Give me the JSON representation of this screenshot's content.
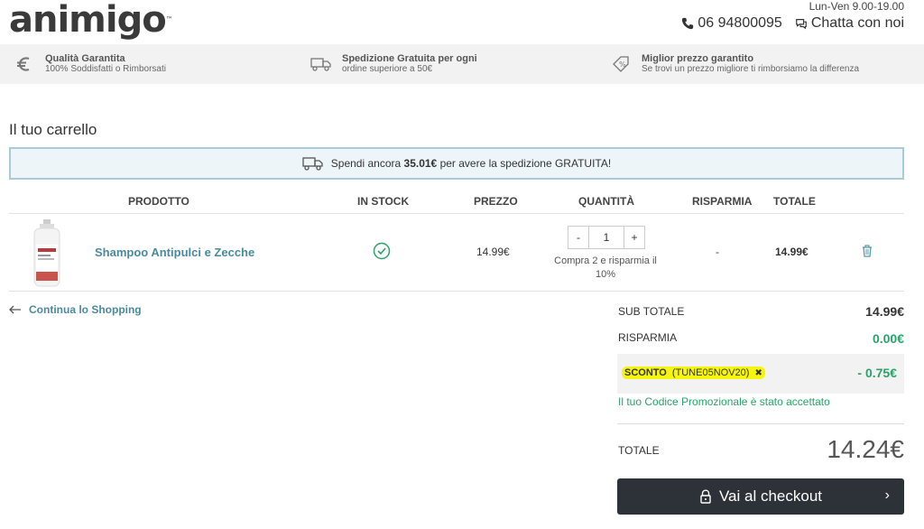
{
  "header": {
    "logo": "animigo",
    "logo_tm": "™",
    "hours": "Lun-Ven 9.00-19.00",
    "phone": "06 94800095",
    "chat": "Chatta con noi"
  },
  "benefits": [
    {
      "icon": "euro-icon",
      "title": "Qualità Garantita",
      "subtitle": "100% Soddisfatti o Rimborsati"
    },
    {
      "icon": "truck-icon",
      "title": "Spedizione Gratuita per ogni",
      "subtitle": "ordine superiore a 50€"
    },
    {
      "icon": "percent-tag-icon",
      "title": "Miglior prezzo garantito",
      "subtitle": "Se trovi un prezzo migliore ti rimborsiamo la differenza"
    }
  ],
  "cart": {
    "title": "Il tuo carrello",
    "shipping_banner": {
      "prefix": "Spendi ancora",
      "amount": "35.01€",
      "suffix": "per avere la spedizione GRATUITA!"
    },
    "columns": {
      "product": "PRODOTTO",
      "in_stock": "IN STOCK",
      "price": "PREZZO",
      "quantity": "QUANTITÀ",
      "savings": "RISPARMIA",
      "total": "TOTALE"
    },
    "items": [
      {
        "name": "Shampoo Antipulci e Zecche",
        "in_stock": true,
        "price": "14.99€",
        "qty_minus": "-",
        "qty": "1",
        "qty_plus": "+",
        "promo_note": "Compra 2 e risparmia il 10%",
        "savings": "-",
        "total": "14.99€"
      }
    ],
    "continue_label": "Continua lo Shopping"
  },
  "summary": {
    "subtotal_label": "SUB TOTALE",
    "subtotal_value": "14.99€",
    "savings_label": "RISPARMIA",
    "savings_value": "0.00€",
    "discount_label": "SCONTO",
    "discount_code": "(TUNE05NOV20)",
    "discount_remove": "✖",
    "discount_value": "- 0.75€",
    "accepted_message": "Il tuo Codice Promozionale è stato accettato",
    "total_label": "TOTALE",
    "total_value": "14.24€",
    "checkout_label": "Vai al checkout",
    "checkout_chevron": "›"
  },
  "colors": {
    "accent_teal": "#4a8a9c",
    "success_green": "#2aa26a",
    "checkout_bg": "#2d3138",
    "highlight_yellow": "#f5f50f"
  }
}
